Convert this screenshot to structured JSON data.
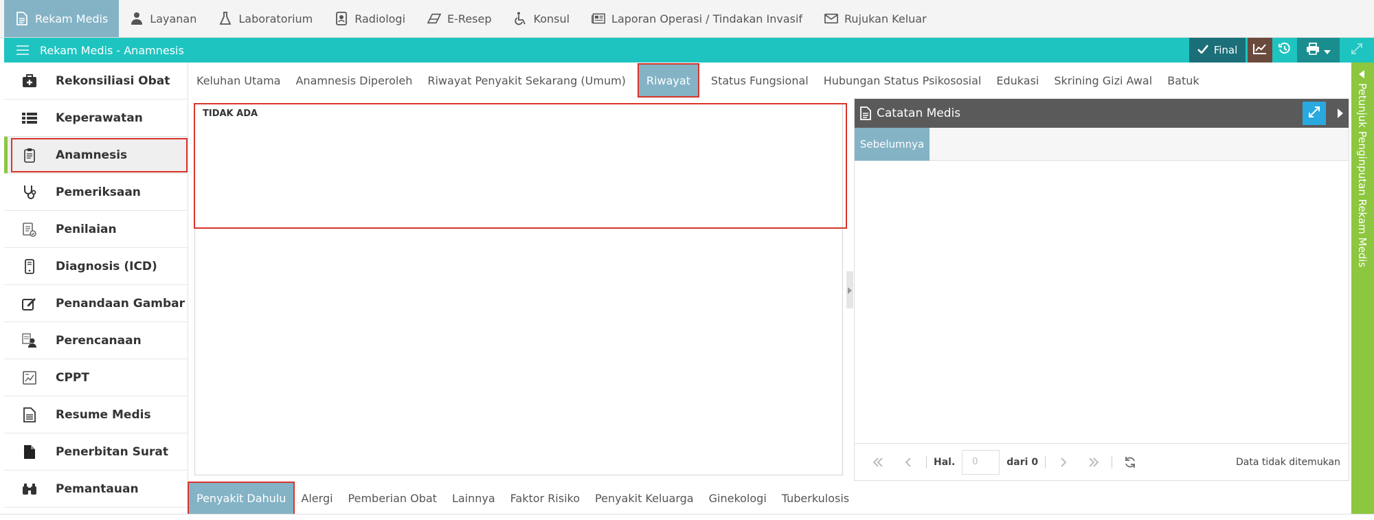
{
  "topnav": {
    "items": [
      {
        "label": "Rekam Medis",
        "icon": "document-icon",
        "active": true
      },
      {
        "label": "Layanan",
        "icon": "doctor-icon"
      },
      {
        "label": "Laboratorium",
        "icon": "flask-icon"
      },
      {
        "label": "Radiologi",
        "icon": "id-badge-icon"
      },
      {
        "label": "E-Resep",
        "icon": "eraser-icon"
      },
      {
        "label": "Konsul",
        "icon": "wheelchair-icon"
      },
      {
        "label": "Laporan Operasi / Tindakan Invasif",
        "icon": "newspaper-icon"
      },
      {
        "label": "Rujukan Keluar",
        "icon": "envelope-icon"
      }
    ]
  },
  "titlebar": {
    "title": "Rekam Medis - Anamnesis",
    "final_label": "Final"
  },
  "sidebar": {
    "items": [
      {
        "label": "Rekonsiliasi Obat",
        "icon": "medkit-icon"
      },
      {
        "label": "Keperawatan",
        "icon": "list-icon"
      },
      {
        "label": "Anamnesis",
        "icon": "clipboard-icon",
        "active": true
      },
      {
        "label": "Pemeriksaan",
        "icon": "stethoscope-icon"
      },
      {
        "label": "Penilaian",
        "icon": "clipboard-check-icon"
      },
      {
        "label": "Diagnosis (ICD)",
        "icon": "mobile-icon"
      },
      {
        "label": "Penandaan Gambar",
        "icon": "edit-icon"
      },
      {
        "label": "Perencanaan",
        "icon": "user-doc-icon"
      },
      {
        "label": "CPPT",
        "icon": "chart-doc-icon"
      },
      {
        "label": "Resume Medis",
        "icon": "file-text-icon"
      },
      {
        "label": "Penerbitan Surat",
        "icon": "file-icon"
      },
      {
        "label": "Pemantauan",
        "icon": "binoculars-icon"
      }
    ]
  },
  "tabs_top": [
    {
      "label": "Keluhan Utama"
    },
    {
      "label": "Anamnesis Diperoleh"
    },
    {
      "label": "Riwayat Penyakit Sekarang (Umum)"
    },
    {
      "label": "Riwayat",
      "active": true
    },
    {
      "label": "Status Fungsional"
    },
    {
      "label": "Hubungan Status Psikososial"
    },
    {
      "label": "Edukasi"
    },
    {
      "label": "Skrining Gizi Awal"
    },
    {
      "label": "Batuk"
    }
  ],
  "editor": {
    "text": "TIDAK ADA"
  },
  "right_panel": {
    "title": "Catatan Medis",
    "tab_label": "Sebelumnya",
    "pager": {
      "hal_label": "Hal.",
      "page_placeholder": "0",
      "dari_label": "dari 0",
      "message": "Data tidak ditemukan"
    }
  },
  "vstrip": {
    "label": "Petunjuk Penginputan Rekam Medis"
  },
  "tabs_bottom": [
    {
      "label": "Penyakit Dahulu",
      "active": true
    },
    {
      "label": "Alergi"
    },
    {
      "label": "Pemberian Obat"
    },
    {
      "label": "Lainnya"
    },
    {
      "label": "Faktor Risiko"
    },
    {
      "label": "Penyakit Keluarga"
    },
    {
      "label": "Ginekologi"
    },
    {
      "label": "Tuberkulosis"
    }
  ]
}
